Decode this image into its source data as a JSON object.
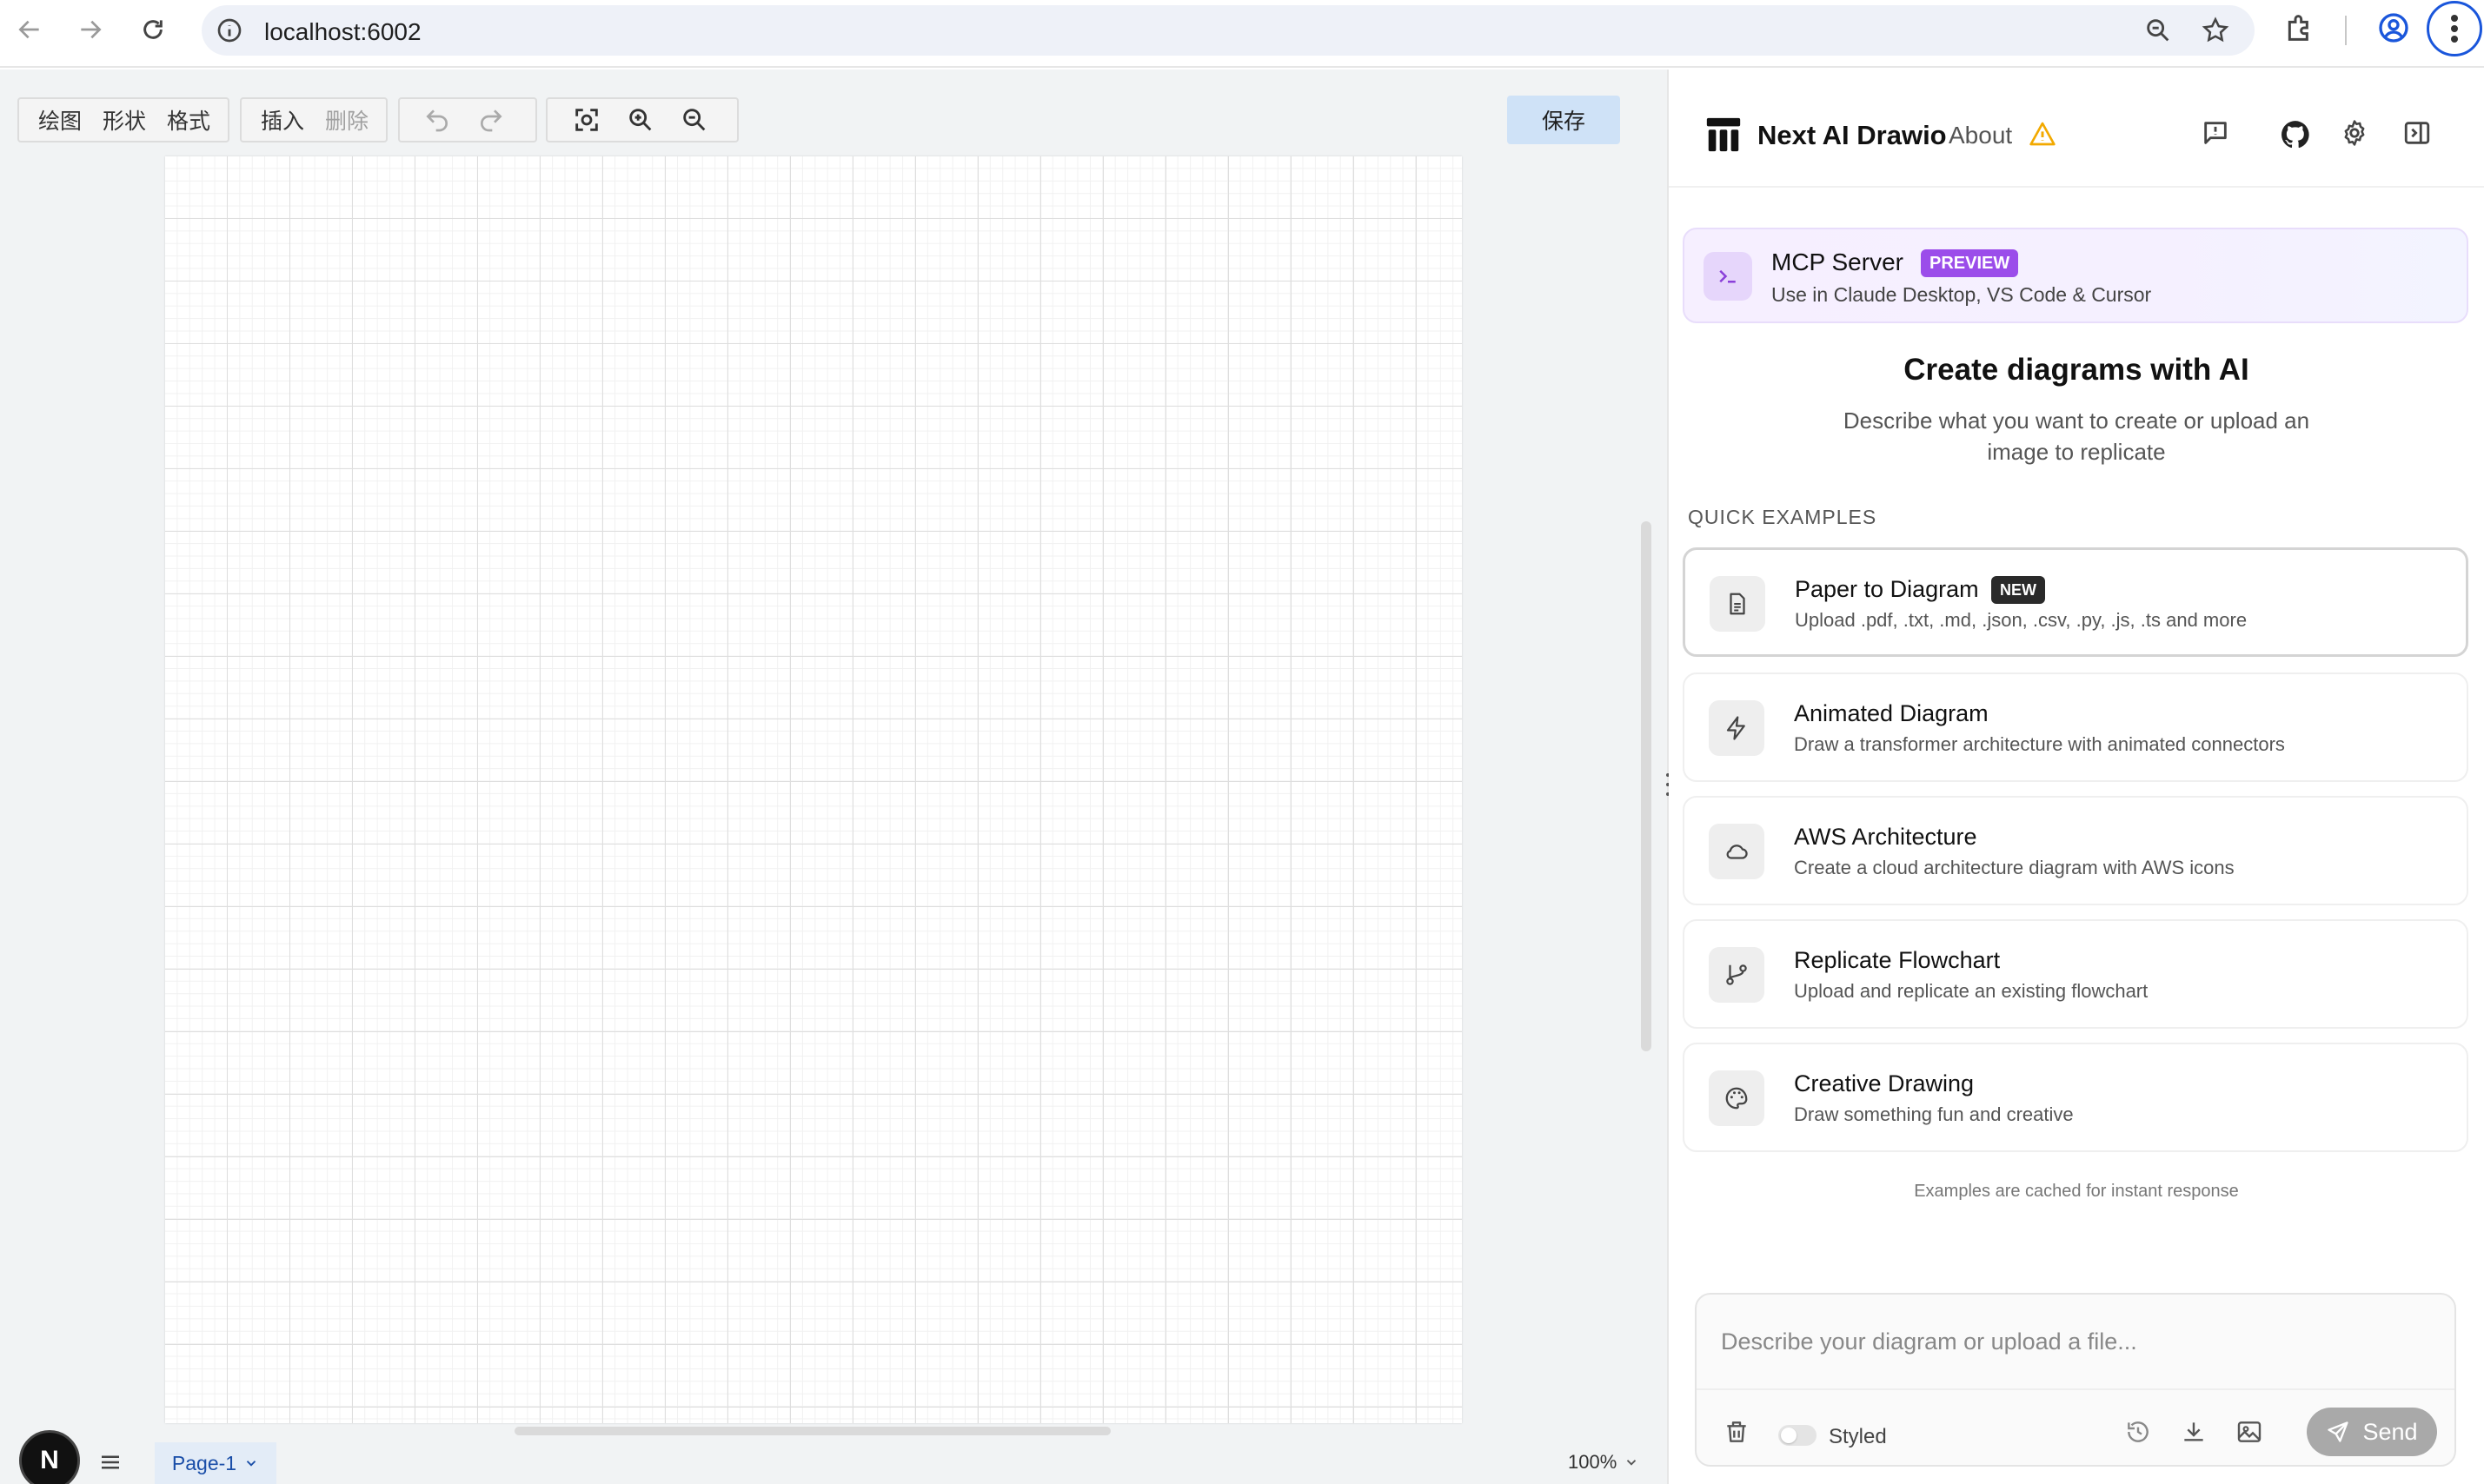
{
  "browser": {
    "url": "localhost:6002"
  },
  "editor": {
    "menu": [
      "绘图",
      "形状",
      "格式"
    ],
    "edit": [
      "插入",
      "删除"
    ],
    "save_label": "保存",
    "page_tab": "Page-1",
    "zoom_level": "100%",
    "avatar_letter": "N"
  },
  "panel": {
    "app_title": "Next AI Drawio",
    "about_label": "About",
    "mcp": {
      "title": "MCP Server",
      "badge": "PREVIEW",
      "subtitle": "Use in Claude Desktop, VS Code & Cursor"
    },
    "hero": {
      "title": "Create diagrams with AI",
      "subtitle": "Describe what you want to create or upload an image to replicate"
    },
    "quick_examples_label": "QUICK EXAMPLES",
    "examples": [
      {
        "title": "Paper to Diagram",
        "subtitle": "Upload .pdf, .txt, .md, .json, .csv, .py, .js, .ts and more",
        "badge": "NEW",
        "icon": "file-text-icon"
      },
      {
        "title": "Animated Diagram",
        "subtitle": "Draw a transformer architecture with animated connectors",
        "icon": "lightning-icon"
      },
      {
        "title": "AWS Architecture",
        "subtitle": "Create a cloud architecture diagram with AWS icons",
        "icon": "cloud-icon"
      },
      {
        "title": "Replicate Flowchart",
        "subtitle": "Upload and replicate an existing flowchart",
        "icon": "git-branch-icon"
      },
      {
        "title": "Creative Drawing",
        "subtitle": "Draw something fun and creative",
        "icon": "palette-icon"
      }
    ],
    "cached_note": "Examples are cached for instant response",
    "composer": {
      "placeholder": "Describe your diagram or upload a file...",
      "styled_label": "Styled",
      "send_label": "Send"
    }
  },
  "colors": {
    "accent_purple": "#9b4dea",
    "save_button": "#cfe2f7",
    "send_button": "#a9a9a9",
    "warning": "#f2a900"
  }
}
